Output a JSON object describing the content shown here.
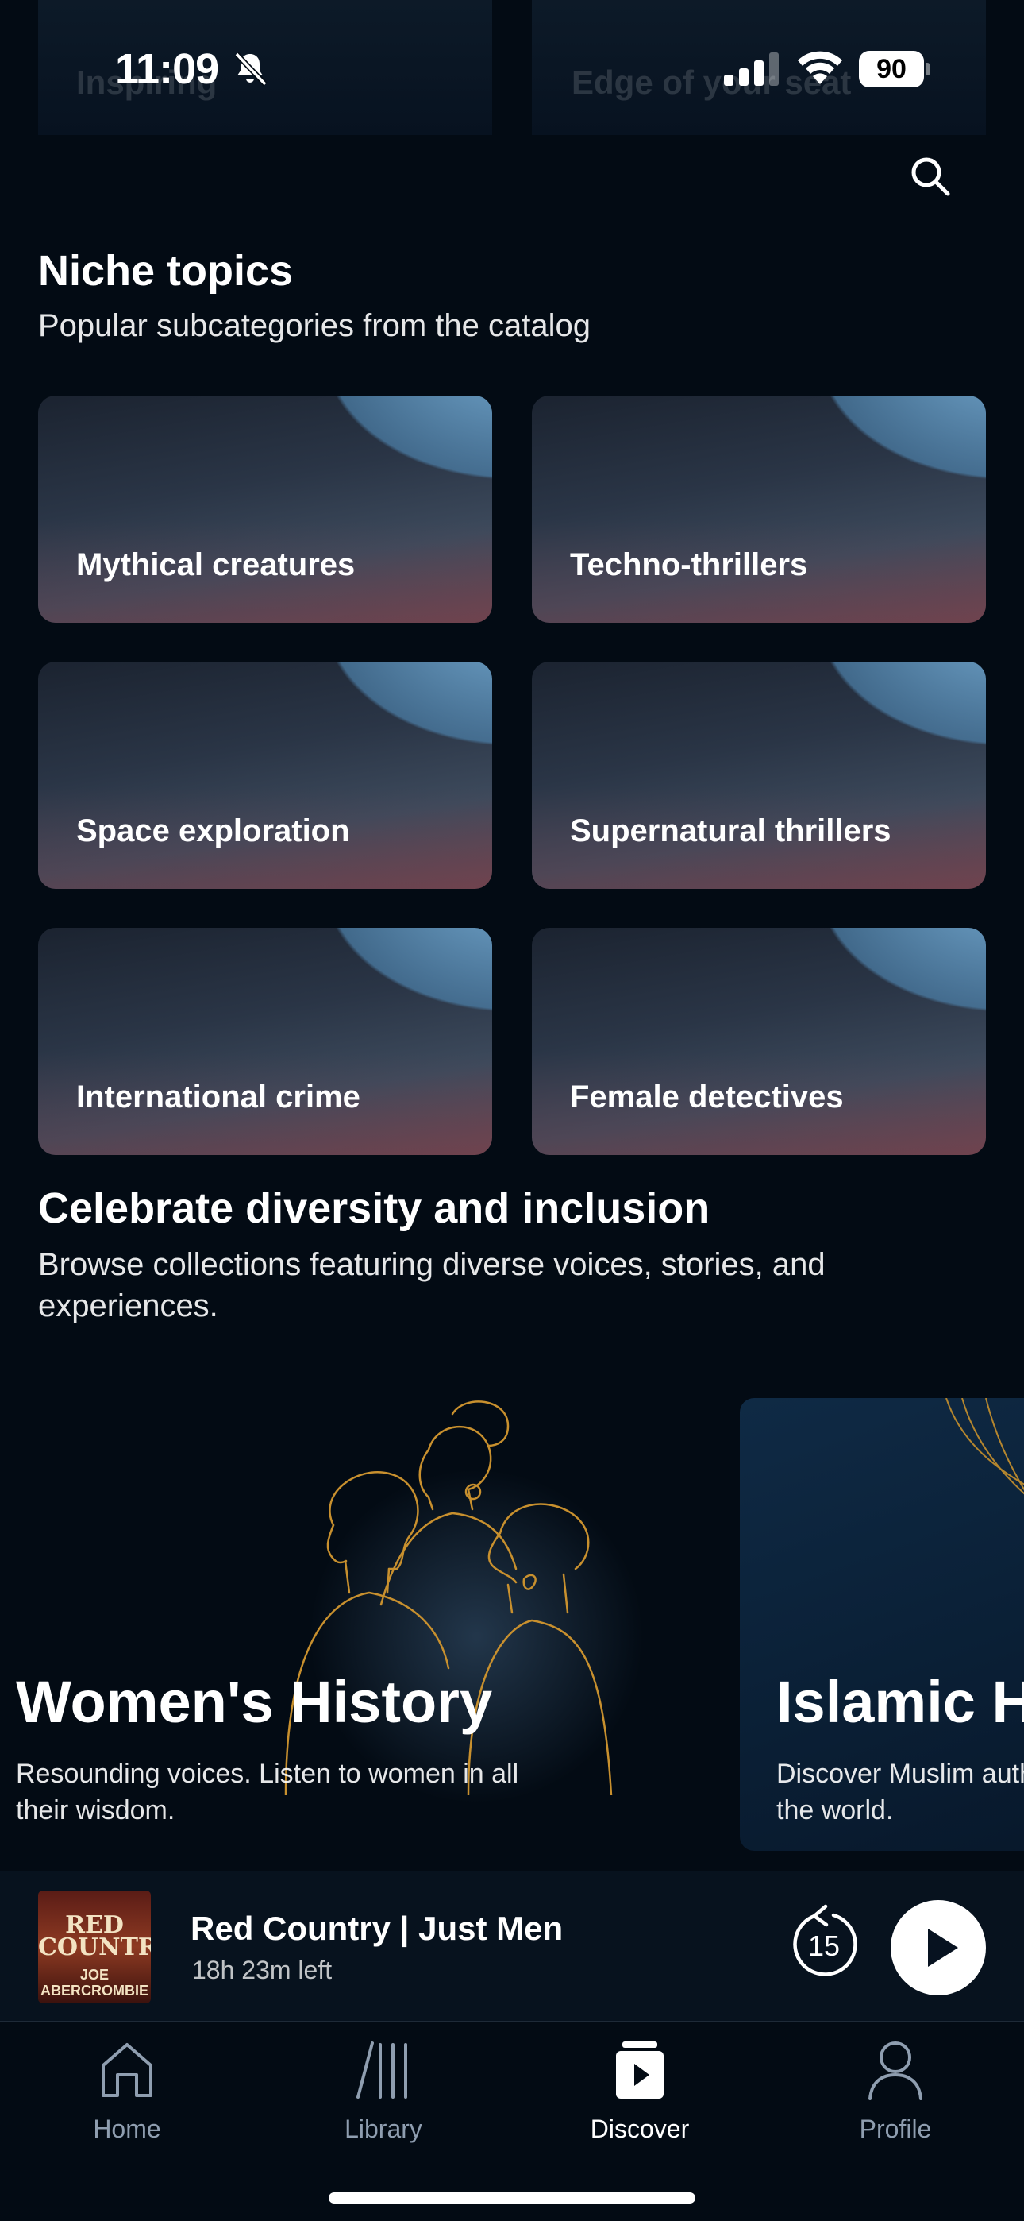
{
  "status_bar": {
    "time": "11:09",
    "battery": "90"
  },
  "behind": {
    "left_label": "Inspiring",
    "right_label": "Edge of your seat"
  },
  "header": {
    "search_icon": "search-icon"
  },
  "niche": {
    "title": "Niche topics",
    "subtitle": "Popular subcategories from the catalog",
    "cards": [
      {
        "label": "Mythical creatures"
      },
      {
        "label": "Techno-thrillers"
      },
      {
        "label": "Space exploration"
      },
      {
        "label": "Supernatural thrillers"
      },
      {
        "label": "International crime"
      },
      {
        "label": "Female detectives"
      }
    ]
  },
  "diversity": {
    "title": "Celebrate diversity and inclusion",
    "subtitle": "Browse collections featuring diverse voices, stories, and experiences.",
    "collections": [
      {
        "title": "Women's History",
        "desc": "Resounding voices. Listen to women in all their wisdom."
      },
      {
        "title": "Islamic Heritage",
        "desc": "Discover Muslim authors from around the world."
      }
    ]
  },
  "player": {
    "title": "Red Country | Just Men",
    "time_left": "18h 23m left",
    "cover_title": "RED COUNTRY",
    "cover_author": "JOE ABERCROMBIE",
    "skip_seconds": "15"
  },
  "tabs": [
    {
      "label": "Home",
      "icon": "home-icon",
      "active": false
    },
    {
      "label": "Library",
      "icon": "library-icon",
      "active": false
    },
    {
      "label": "Discover",
      "icon": "discover-icon",
      "active": true
    },
    {
      "label": "Profile",
      "icon": "profile-icon",
      "active": false
    }
  ],
  "colors": {
    "background": "#030b14",
    "accent_gold": "#c8902e",
    "inactive_tab": "#8f9eb0"
  }
}
